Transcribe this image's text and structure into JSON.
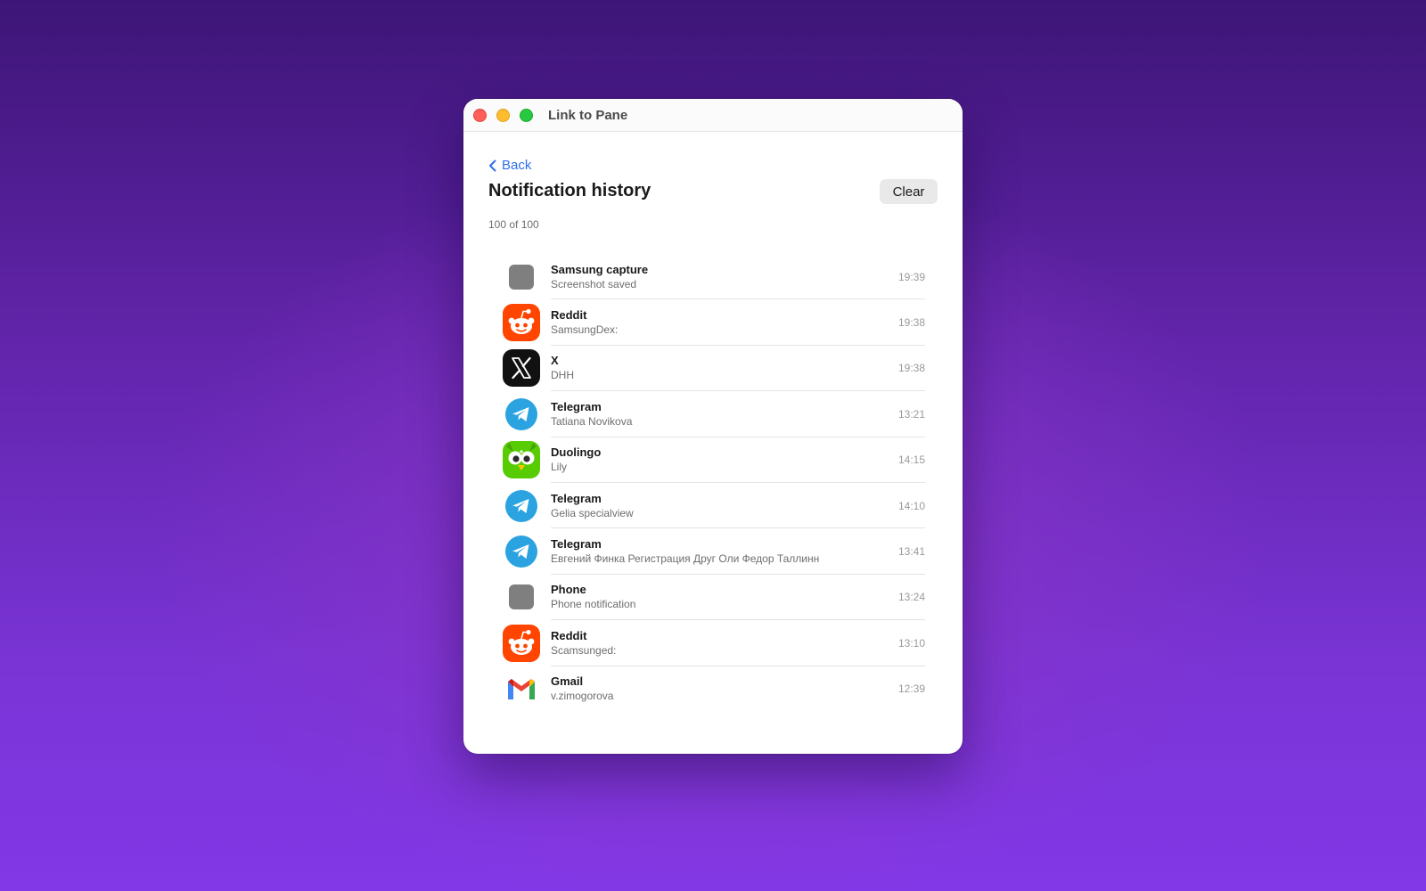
{
  "window": {
    "title": "Link to Pane"
  },
  "header": {
    "back_label": "Back",
    "title": "Notification history",
    "clear_label": "Clear",
    "count": "100 of 100"
  },
  "notifications": [
    {
      "app": "Samsung capture",
      "text": "Screenshot saved",
      "time": "19:39",
      "icon": "generic-app-icon"
    },
    {
      "app": "Reddit",
      "text": "SamsungDex:",
      "time": "19:38",
      "icon": "reddit-icon"
    },
    {
      "app": "X",
      "text": "DHH",
      "time": "19:38",
      "icon": "x-icon"
    },
    {
      "app": "Telegram",
      "text": "Tatiana Novikova",
      "time": "13:21",
      "icon": "telegram-icon"
    },
    {
      "app": "Duolingo",
      "text": "Lily",
      "time": "14:15",
      "icon": "duolingo-icon"
    },
    {
      "app": "Telegram",
      "text": "Gelia specialview",
      "time": "14:10",
      "icon": "telegram-icon"
    },
    {
      "app": "Telegram",
      "text": "Евгений Финка Регистрация Друг Оли Федор Таллинн",
      "time": "13:41",
      "icon": "telegram-icon"
    },
    {
      "app": "Phone",
      "text": "Phone notification",
      "time": "13:24",
      "icon": "generic-app-icon"
    },
    {
      "app": "Reddit",
      "text": "Scamsunged:",
      "time": "13:10",
      "icon": "reddit-icon"
    },
    {
      "app": "Gmail",
      "text": "v.zimogorova",
      "time": "12:39",
      "icon": "gmail-icon"
    },
    {
      "app": "Telegram",
      "text": "",
      "time": "",
      "icon": "telegram-icon"
    }
  ],
  "colors": {
    "accent": "#2f6fea",
    "reddit": "#ff4500",
    "telegram": "#2aa3e0",
    "duolingo": "#58cc02"
  }
}
